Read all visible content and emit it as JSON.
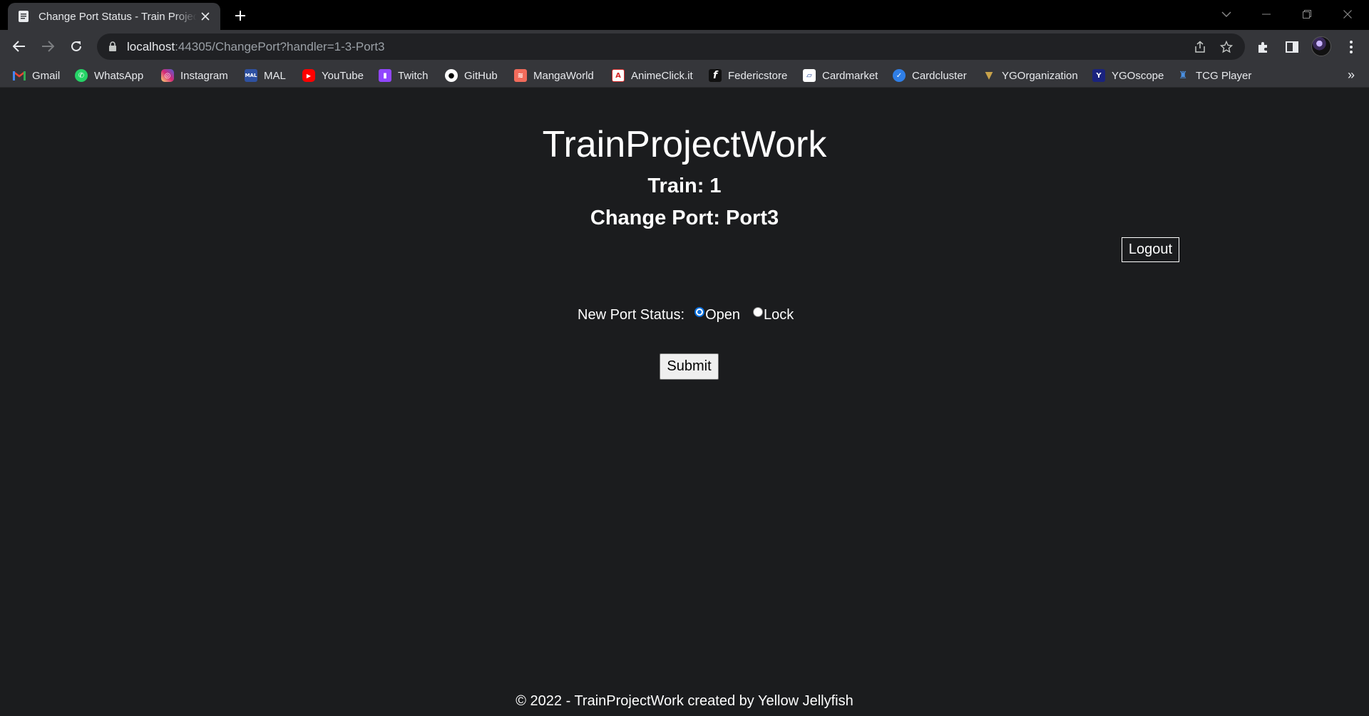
{
  "browser": {
    "tab_title": "Change Port Status - Train Project",
    "url_host": "localhost",
    "url_rest": ":44305/ChangePort?handler=1-3-Port3",
    "bookmarks": [
      {
        "label": "Gmail",
        "icon": "gmail-icon",
        "color": "#ea4335"
      },
      {
        "label": "WhatsApp",
        "icon": "whatsapp-icon",
        "color": "#25d366"
      },
      {
        "label": "Instagram",
        "icon": "instagram-icon",
        "color": "#d6249f"
      },
      {
        "label": "MAL",
        "icon": "mal-icon",
        "color": "#2e51a2"
      },
      {
        "label": "YouTube",
        "icon": "youtube-icon",
        "color": "#ff0000"
      },
      {
        "label": "Twitch",
        "icon": "twitch-icon",
        "color": "#9146ff"
      },
      {
        "label": "GitHub",
        "icon": "github-icon",
        "color": "#ffffff"
      },
      {
        "label": "MangaWorld",
        "icon": "mangaworld-icon",
        "color": "#f26b5b"
      },
      {
        "label": "AnimeClick.it",
        "icon": "animeclick-icon",
        "color": "#d62828"
      },
      {
        "label": "Federicstore",
        "icon": "federicstore-icon",
        "color": "#111111"
      },
      {
        "label": "Cardmarket",
        "icon": "cardmarket-icon",
        "color": "#1c3f94"
      },
      {
        "label": "Cardcluster",
        "icon": "cardcluster-icon",
        "color": "#2f7ee6"
      },
      {
        "label": "YGOrganization",
        "icon": "ygorganization-icon",
        "color": "#c8a24a"
      },
      {
        "label": "YGOscope",
        "icon": "ygoscope-icon",
        "color": "#1a237e"
      },
      {
        "label": "TCG Player",
        "icon": "tcgplayer-icon",
        "color": "#4a90e2"
      }
    ],
    "more_bookmarks": "»"
  },
  "page": {
    "site_title": "TrainProjectWork",
    "train_line": "Train: 1",
    "port_line": "Change Port: Port3",
    "logout_label": "Logout",
    "status_label": "New Port Status:",
    "options": [
      {
        "label": "Open",
        "checked": true
      },
      {
        "label": "Lock",
        "checked": false
      }
    ],
    "submit_label": "Submit",
    "footer": "© 2022 - TrainProjectWork created by Yellow Jellyfish"
  },
  "colors": {
    "page_bg": "#1b1c1e",
    "chrome_bg": "#35363a",
    "radio_accent": "#0b70de"
  }
}
